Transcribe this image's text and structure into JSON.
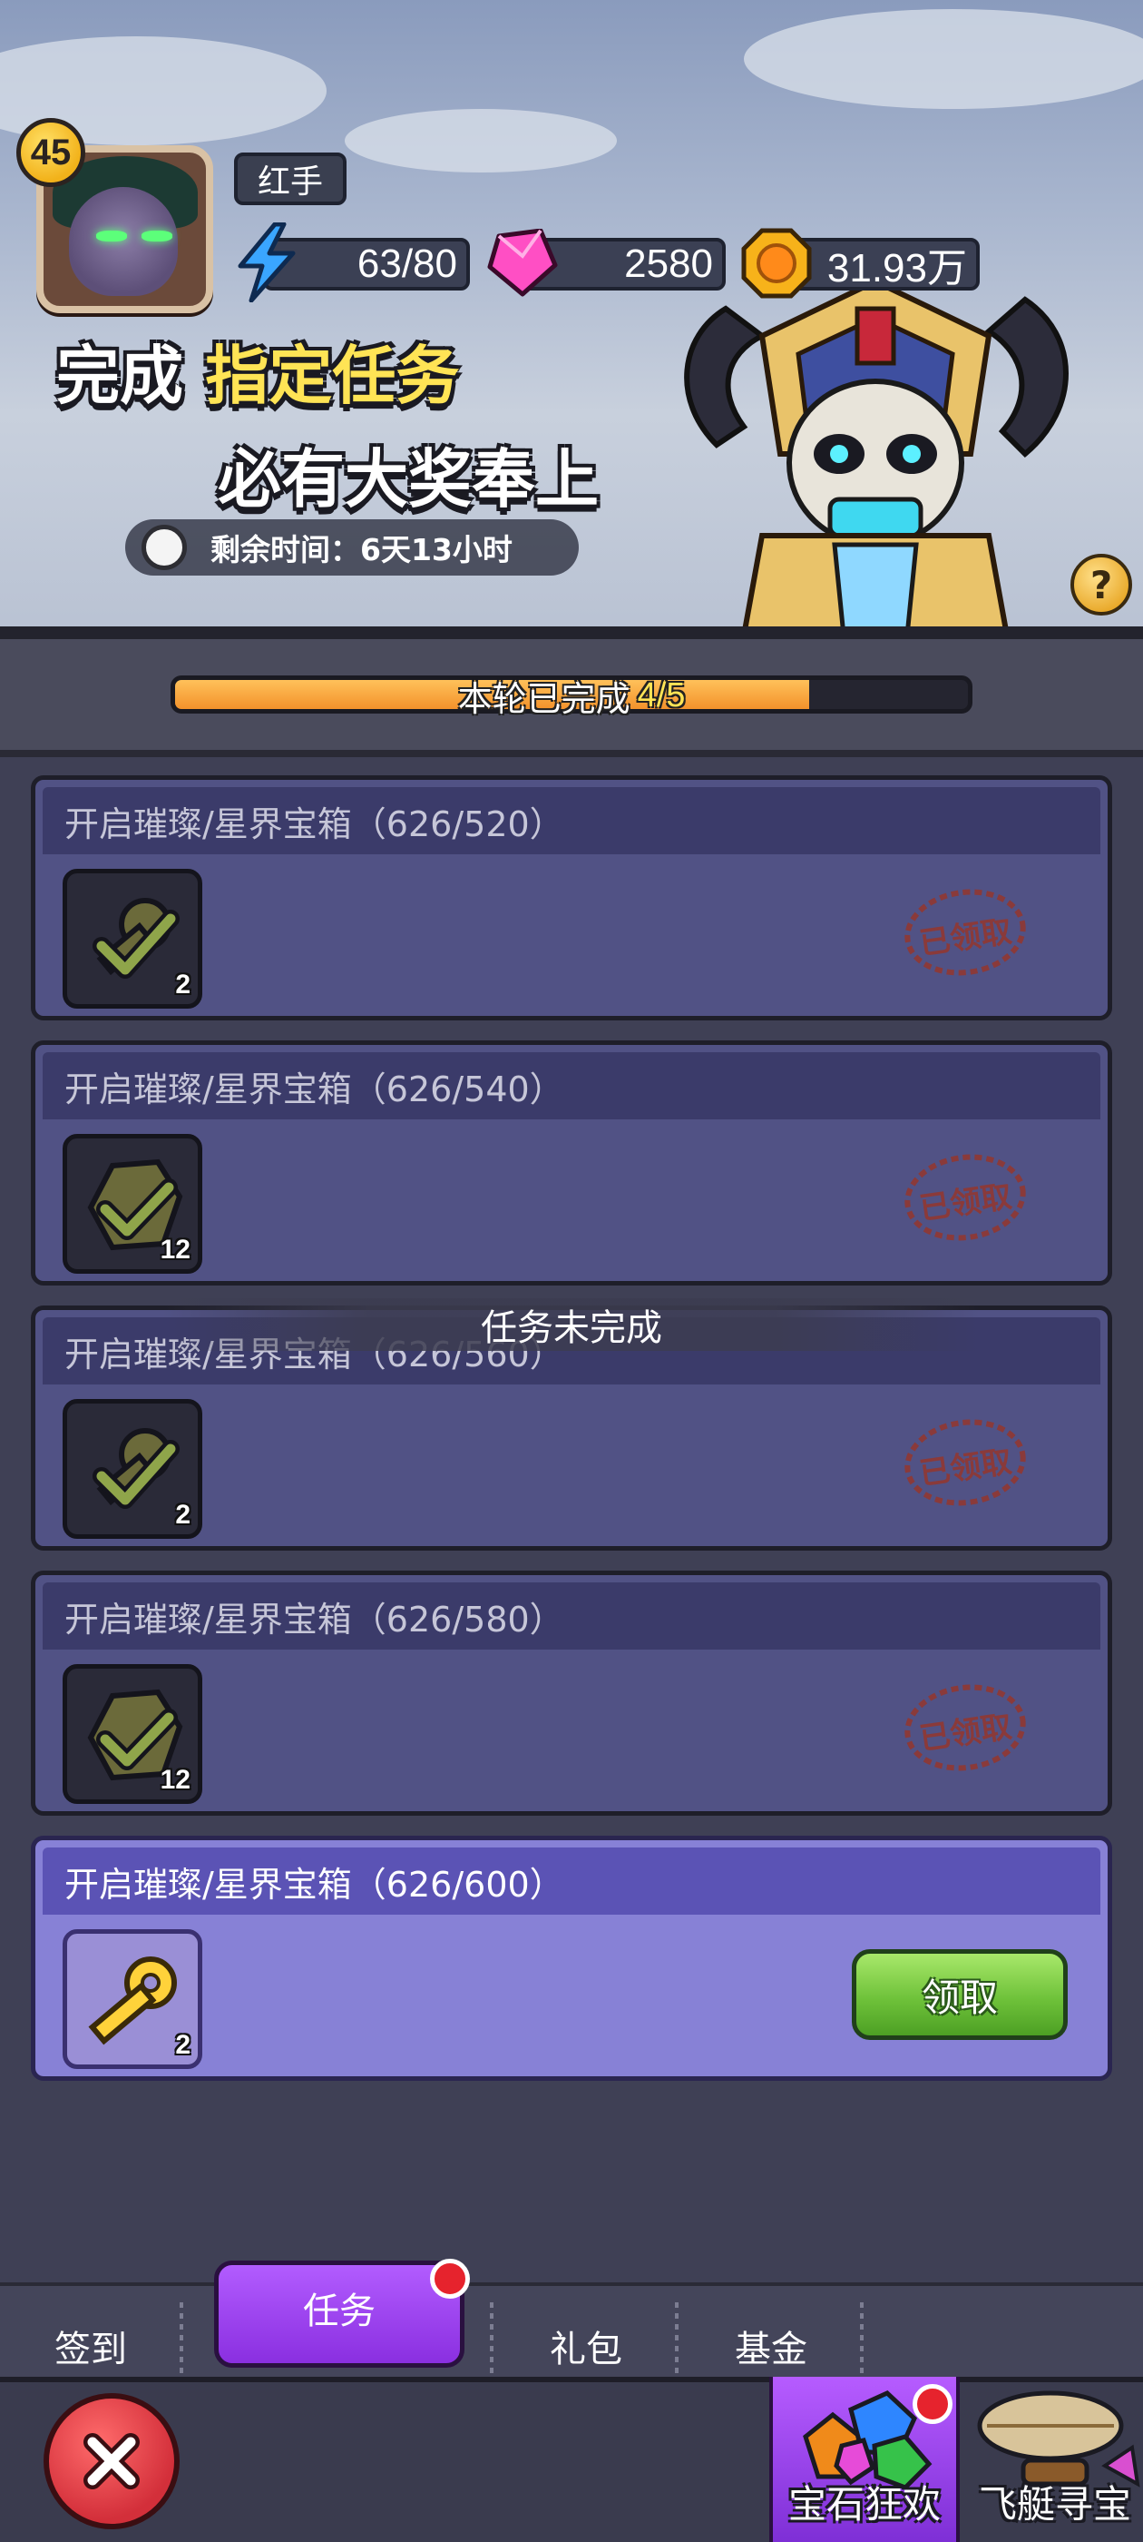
{
  "header": {
    "level": "45",
    "player_name": "红手",
    "energy": "63/80",
    "gems": "2580",
    "gold": "31.93万",
    "headline_prefix": "完成",
    "headline_highlight": "指定任务",
    "headline_line2": "必有大奖奉上",
    "remaining_time": "剩余时间：6天13小时",
    "help_label": "?"
  },
  "progress": {
    "label": "本轮已完成",
    "count": "4/5",
    "fraction": 0.8
  },
  "tasks": [
    {
      "title": "开启璀璨/星界宝箱（626/520）",
      "reward_icon": "key-icon",
      "reward_count": "2",
      "status": "已领取"
    },
    {
      "title": "开启璀璨/星界宝箱（626/540）",
      "reward_icon": "ore-icon",
      "reward_count": "12",
      "status": "已领取"
    },
    {
      "title": "开启璀璨/星界宝箱（626/560）",
      "reward_icon": "key-icon",
      "reward_count": "2",
      "status": "已领取"
    },
    {
      "title": "开启璀璨/星界宝箱（626/580）",
      "reward_icon": "ore-icon",
      "reward_count": "12",
      "status": "已领取"
    },
    {
      "title": "开启璀璨/星界宝箱（626/600）",
      "reward_icon": "key-icon",
      "reward_count": "2",
      "claim_label": "领取"
    }
  ],
  "toast": "任务未完成",
  "tabs": [
    {
      "label": "签到"
    },
    {
      "label": "任务",
      "active": true,
      "badge": true
    },
    {
      "label": "礼包"
    },
    {
      "label": "基金"
    }
  ],
  "features": [
    {
      "label": "宝石狂欢",
      "icon": "gems-icon",
      "active": true,
      "badge": true
    },
    {
      "label": "飞艇寻宝",
      "icon": "airship-icon"
    }
  ],
  "colors": {
    "accent_purple": "#9b45f0",
    "progress_orange": "#f3922b",
    "claim_green": "#6fc23a",
    "badge_red": "#e6232d",
    "headline_yellow": "#ffe455"
  }
}
